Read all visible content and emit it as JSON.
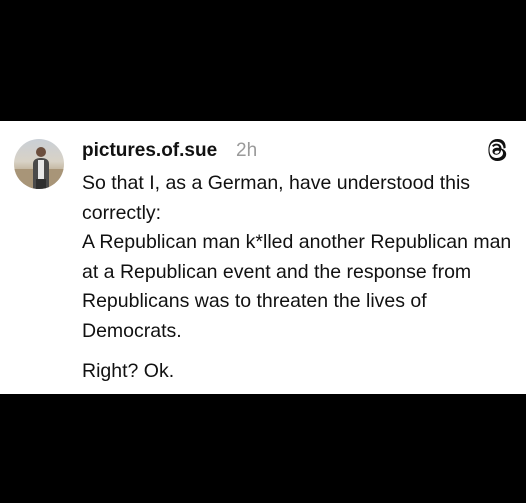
{
  "post": {
    "author": {
      "username": "pictures.of.sue",
      "timestamp": "2h"
    },
    "app_icon": "threads-icon",
    "avatar_icon": "user-avatar",
    "paragraphs": {
      "intro": "So that I, as a German, have understood this correctly:",
      "main": "A Republican man k*lled another Republican man at a Republican event and the response from Republicans was to threaten the lives of Democrats.",
      "closing": "Right? Ok."
    }
  },
  "colors": {
    "background": "#000000",
    "card": "#ffffff",
    "text": "#111111",
    "timestamp": "#9a9a9a"
  }
}
